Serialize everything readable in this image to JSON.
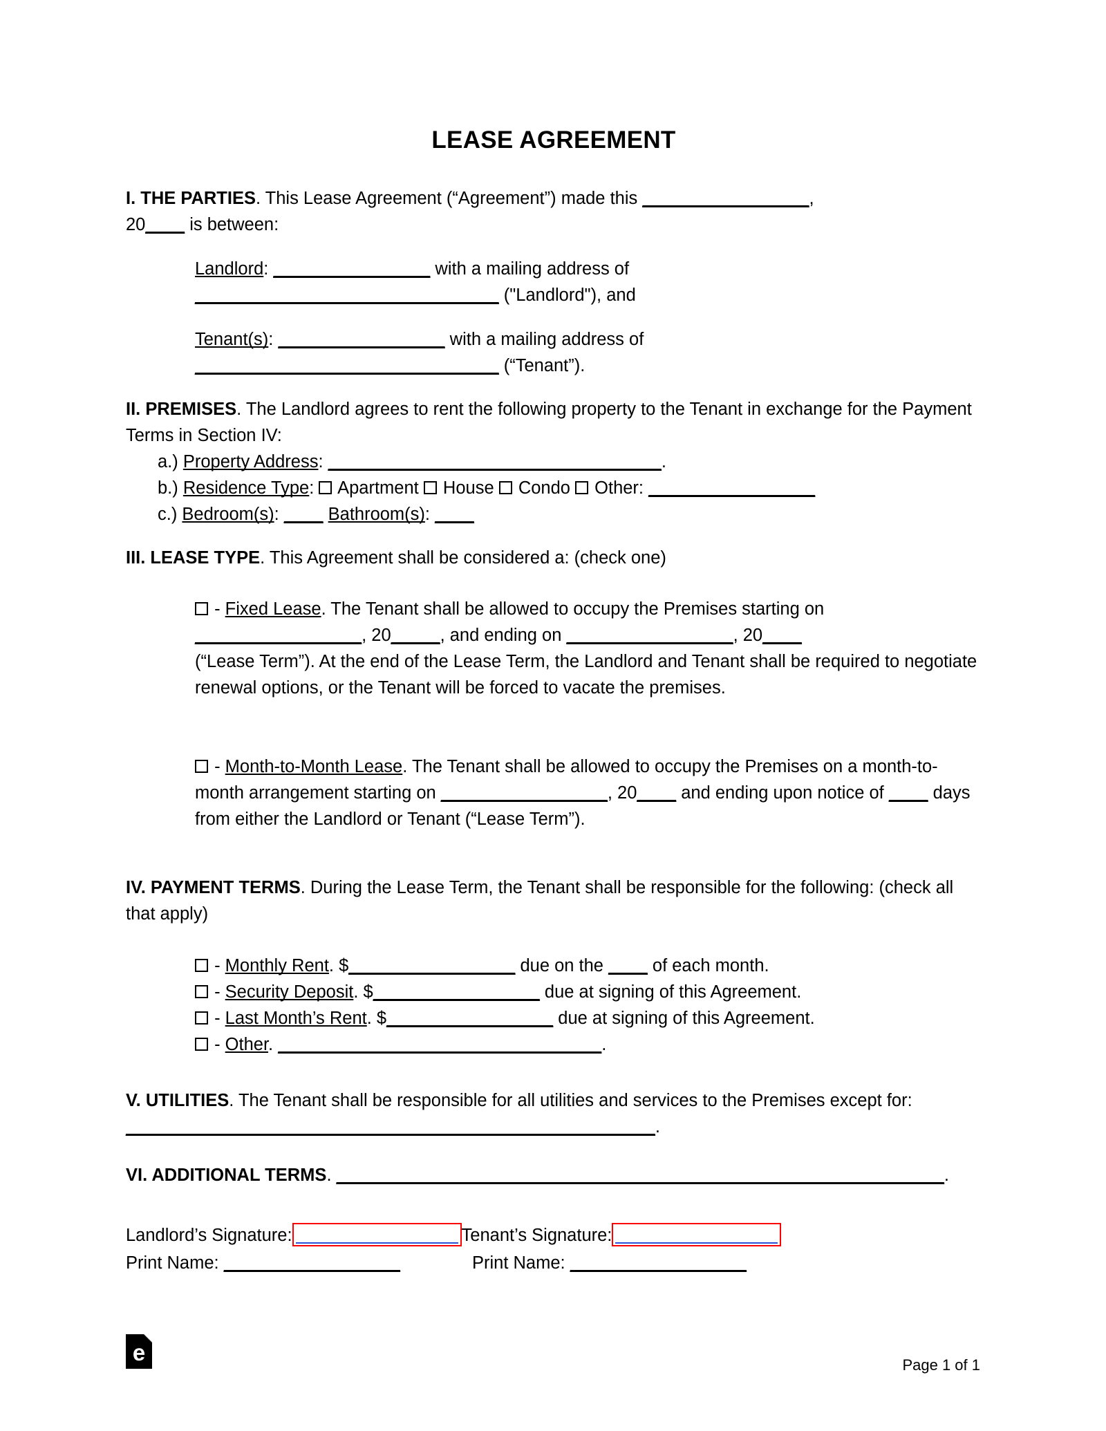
{
  "document": {
    "title": "LEASE AGREEMENT"
  },
  "sections": {
    "parties": {
      "heading": "I. THE PARTIES",
      "intro_a": ". This Lease Agreement (“Agreement”) made this ",
      "blank_date": "_________________",
      "intro_b": ",",
      "line2_prefix": "20",
      "line2_blank": "____",
      "line2_suffix": " is between:",
      "landlord_label": "Landlord",
      "landlord_colon": ": ",
      "landlord_blank": "________________",
      "landlord_mid": " with a mailing address of",
      "landlord_addr_blank": "_______________________________",
      "landlord_suffix": " (\"Landlord\"), and",
      "tenant_label": "Tenant(s)",
      "tenant_colon": ": ",
      "tenant_blank": "_________________",
      "tenant_mid": " with a mailing address of",
      "tenant_addr_blank": "_______________________________",
      "tenant_suffix": " (“Tenant”)."
    },
    "premises": {
      "heading": "II. PREMISES",
      "intro": ". The Landlord agrees to rent the following property to the Tenant in exchange for the Payment Terms in Section IV:",
      "item_a_marker": "a.) ",
      "item_a_label": "Property Address",
      "item_a_colon": ": ",
      "item_a_blank": "__________________________________",
      "item_a_suffix": ".",
      "item_b_marker": "b.) ",
      "item_b_label": "Residence Type",
      "item_b_colon": ": ",
      "item_b_opt1": " Apartment",
      "item_b_opt2": " House",
      "item_b_opt3": " Condo",
      "item_b_opt4": " Other: ",
      "item_b_blank": "_________________",
      "item_c_marker": "c.) ",
      "item_c_label1": "Bedroom(s)",
      "item_c_colon1": ": ",
      "item_c_blank1": "____",
      "item_c_label2": "Bathroom(s)",
      "item_c_colon2": ": ",
      "item_c_blank2": "____"
    },
    "lease_type": {
      "heading": "III. LEASE TYPE",
      "intro": ". This Agreement shall be considered a: (check one)",
      "fixed": {
        "dash": " - ",
        "label": "Fixed Lease",
        "text_a": ". The Tenant shall be allowed to occupy the Premises starting on ",
        "blank1": "_________________",
        "mid_a": ", 20",
        "blank2": "_____",
        "mid_b": ", and ending on ",
        "blank3": "_________________",
        "mid_c": ", 20",
        "blank4": "____",
        "text_b": "(“Lease Term”). At the end of the Lease Term, the Landlord and Tenant shall be required to negotiate renewal options, or the Tenant will be forced to vacate the premises."
      },
      "monthly": {
        "dash": " - ",
        "label": "Month-to-Month Lease",
        "text_a": ". The Tenant shall be allowed to occupy the Premises on a month-to-month arrangement starting on ",
        "blank1": "_________________",
        "mid_a": ", 20",
        "blank2": "____",
        "mid_b": " and ending upon notice of ",
        "blank3": "____",
        "text_b": " days from either the Landlord or Tenant (“Lease Term”)."
      }
    },
    "payment_terms": {
      "heading": "IV. PAYMENT TERMS",
      "intro": ". During the Lease Term, the Tenant shall be responsible for the following: (check all that apply)",
      "items": [
        {
          "dash": " - ",
          "label": "Monthly Rent",
          "mid": ". $",
          "blank": "_________________",
          "after": " due on the ",
          "blank2": "____",
          "tail": " of each month."
        },
        {
          "dash": " - ",
          "label": "Security Deposit",
          "mid": ". $",
          "blank": "_________________",
          "after": " due at signing of this Agreement.",
          "blank2": "",
          "tail": ""
        },
        {
          "dash": " - ",
          "label": "Last Month’s Rent",
          "mid": ". $",
          "blank": "_________________",
          "after": " due at signing of this Agreement.",
          "blank2": "",
          "tail": ""
        },
        {
          "dash": " - ",
          "label": "Other",
          "mid": ". ",
          "blank": "_________________________________",
          "after": ".",
          "blank2": "",
          "tail": ""
        }
      ]
    },
    "utilities": {
      "heading": "V. UTILITIES",
      "intro": ". The Tenant shall be responsible for all utilities and services to the Premises except for: ",
      "blank": "______________________________________________________",
      "suffix": "."
    },
    "additional_terms": {
      "heading": "VI. ADDITIONAL TERMS",
      "intro": ". ",
      "blank": "______________________________________________________________",
      "suffix": "."
    },
    "signatures": {
      "landlord_sig_label": "Landlord’s Signature:",
      "tenant_sig_label": "Tenant’s Signature:",
      "landlord_print_label": "Print Name: ",
      "landlord_print_blank": "__________________",
      "tenant_print_label": "Print Name: ",
      "tenant_print_blank": "__________________"
    }
  },
  "footer": {
    "logo_letter": "e",
    "page_number": "Page 1 of 1"
  },
  "colors": {
    "signature_border": "#ff0000",
    "signature_underline": "#2a4fd6",
    "text": "#000000",
    "background": "#ffffff"
  }
}
